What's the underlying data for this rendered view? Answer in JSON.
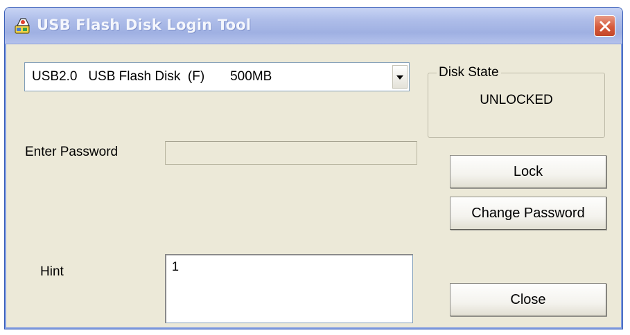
{
  "window": {
    "title": "USB Flash Disk Login Tool"
  },
  "icons": {
    "app": "usb-disk-app-icon",
    "close": "close-icon",
    "dropdown": "chevron-down-icon"
  },
  "drive_select": {
    "value": "USB2.0   USB Flash Disk  (F)       500MB"
  },
  "disk_state": {
    "legend": "Disk State",
    "value": "UNLOCKED"
  },
  "password": {
    "label": "Enter Password",
    "value": ""
  },
  "hint": {
    "label": "Hint",
    "value": "1"
  },
  "buttons": {
    "lock": "Lock",
    "change_password": "Change Password",
    "close": "Close"
  },
  "colors": {
    "title_bar": "#aebde9",
    "close_button": "#d65a3c",
    "dialog_bg": "#ece9d8"
  }
}
